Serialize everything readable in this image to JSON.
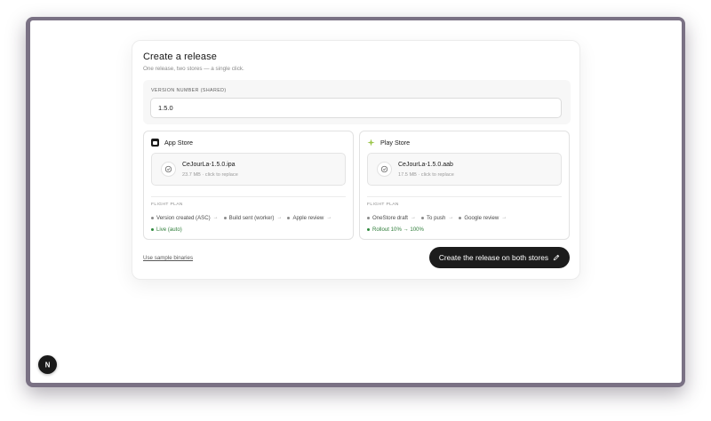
{
  "release": {
    "title": "Create a release",
    "subtitle": "One release, two stores — a single click."
  },
  "version": {
    "label": "VERSION NUMBER (SHARED)",
    "value": "1.5.0"
  },
  "app_store": {
    "name": "App Store",
    "icon": "apple-icon",
    "file_name": "CeJourLa-1.5.0.ipa",
    "file_meta": "23.7 MB · click to replace",
    "flight_label": "FLIGHT PLAN",
    "steps": [
      "Version created (ASC)",
      "Build sent (worker)",
      "Apple review",
      "Live (auto)"
    ]
  },
  "play_store": {
    "name": "Play Store",
    "icon": "play-store-icon",
    "file_name": "CeJourLa-1.5.0.aab",
    "file_meta": "17.5 MB · click to replace",
    "flight_label": "FLIGHT PLAN",
    "steps": [
      "OneStore draft",
      "To push",
      "Google review",
      "Rollout 10% → 100%"
    ]
  },
  "footer": {
    "sample_link": "Use sample binaries",
    "create_button": "Create the release on both stores"
  },
  "dev_badge": {
    "letter": "N"
  },
  "colors": {
    "window_frame": "#7a7184",
    "button_bg": "#1c1c1c",
    "live_green": "#2f7d3a",
    "play_icon": "#9bc64a"
  }
}
